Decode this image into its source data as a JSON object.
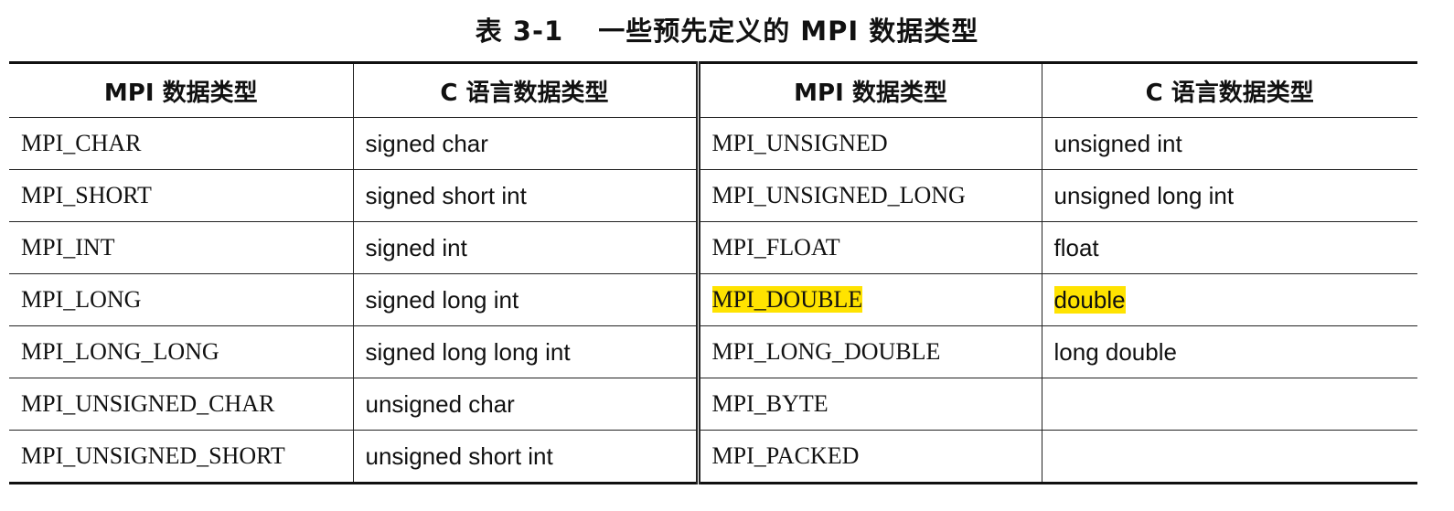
{
  "caption": {
    "number": "表 3-1",
    "title": "一些预先定义的 MPI 数据类型"
  },
  "table": {
    "headers": [
      "MPI 数据类型",
      "C 语言数据类型",
      "MPI 数据类型",
      "C 语言数据类型"
    ],
    "rows": [
      {
        "left_mpi": "MPI_CHAR",
        "left_c": "signed char",
        "right_mpi": "MPI_UNSIGNED",
        "right_c": "unsigned int",
        "highlighted": false
      },
      {
        "left_mpi": "MPI_SHORT",
        "left_c": "signed short int",
        "right_mpi": "MPI_UNSIGNED_LONG",
        "right_c": "unsigned long int",
        "highlighted": false
      },
      {
        "left_mpi": "MPI_INT",
        "left_c": "signed int",
        "right_mpi": "MPI_FLOAT",
        "right_c": "float",
        "highlighted": false
      },
      {
        "left_mpi": "MPI_LONG",
        "left_c": "signed long int",
        "right_mpi": "MPI_DOUBLE",
        "right_c": "double",
        "highlighted": true
      },
      {
        "left_mpi": "MPI_LONG_LONG",
        "left_c": "signed long long int",
        "right_mpi": "MPI_LONG_DOUBLE",
        "right_c": "long double",
        "highlighted": false
      },
      {
        "left_mpi": "MPI_UNSIGNED_CHAR",
        "left_c": "unsigned char",
        "right_mpi": "MPI_BYTE",
        "right_c": "",
        "highlighted": false
      },
      {
        "left_mpi": "MPI_UNSIGNED_SHORT",
        "left_c": "unsigned short int",
        "right_mpi": "MPI_PACKED",
        "right_c": "",
        "highlighted": false
      }
    ]
  },
  "colors": {
    "highlight": "#ffe300",
    "text": "#111111",
    "rule": "#222222"
  }
}
